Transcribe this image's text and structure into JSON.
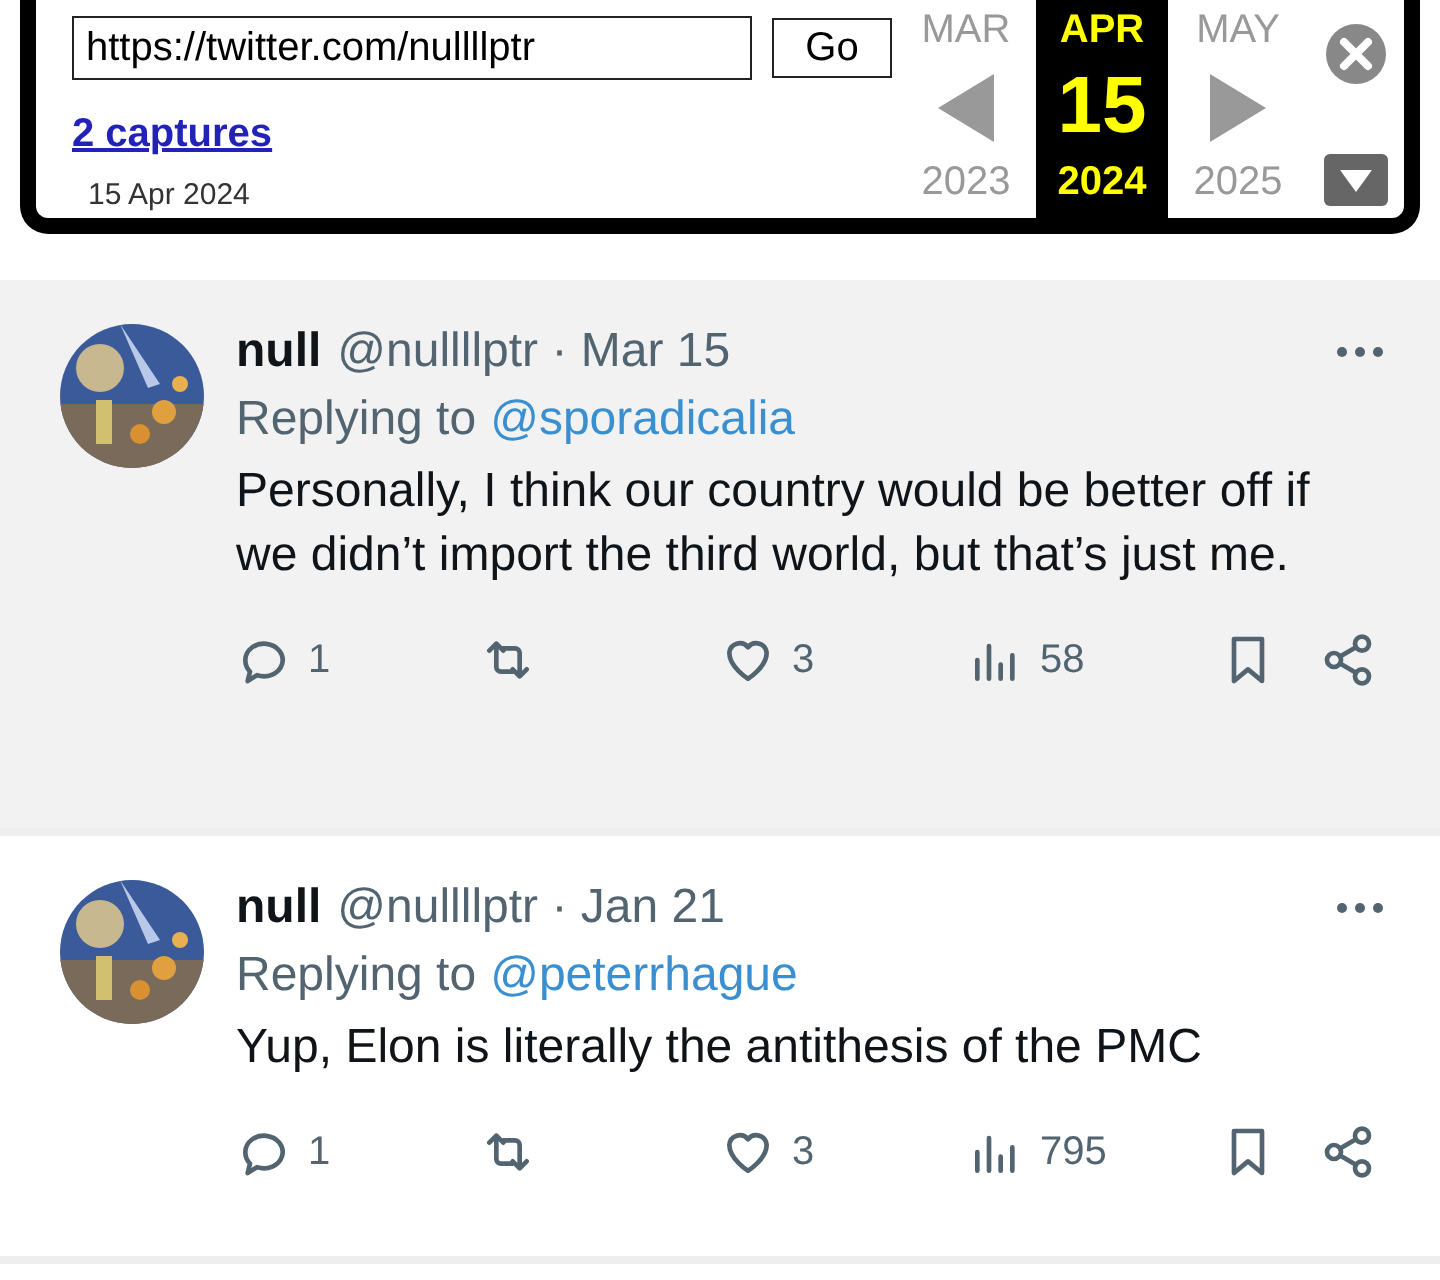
{
  "wayback_bar": {
    "url": "https://twitter.com/nullllptr",
    "go_label": "Go",
    "captures": "2 captures",
    "capture_date": "15 Apr 2024",
    "months": [
      {
        "month": "MAR",
        "year": "2023",
        "selected": false
      },
      {
        "month": "APR",
        "day": "15",
        "year": "2024",
        "selected": true
      },
      {
        "month": "MAY",
        "year": "2025",
        "selected": false
      }
    ]
  },
  "tweets": [
    {
      "highlighted": true,
      "name": "null",
      "handle": "@nullllptr",
      "separator": "·",
      "date": "Mar 15",
      "replying_label": "Replying to",
      "replying_to": "@sporadicalia",
      "text": "Personally, I think our country would be better off if we didn’t import the third world, but that’s just me.",
      "replies": "1",
      "likes": "3",
      "views": "58"
    },
    {
      "highlighted": false,
      "name": "null",
      "handle": "@nullllptr",
      "separator": "·",
      "date": "Jan 21",
      "replying_label": "Replying to",
      "replying_to": "@peterrhague",
      "text": "Yup, Elon is literally the antithesis of the PMC",
      "replies": "1",
      "likes": "3",
      "views": "795"
    }
  ]
}
